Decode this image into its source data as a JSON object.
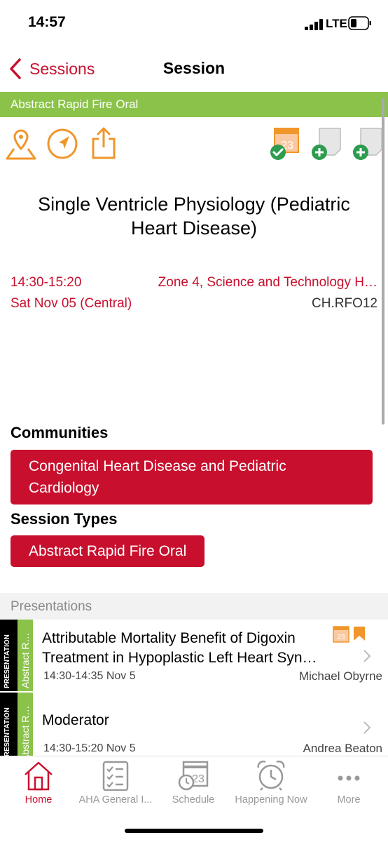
{
  "status": {
    "time": "14:57",
    "network": "LTE"
  },
  "nav": {
    "back_label": "Sessions",
    "title": "Session"
  },
  "banner": {
    "label": "Abstract Rapid Fire Oral"
  },
  "toolbar": {
    "icons": [
      "map-pin-icon",
      "navigate-icon",
      "share-icon",
      "calendar-added-icon",
      "add-note-icon",
      "add-note-icon"
    ],
    "calendar_day": "23"
  },
  "session": {
    "title": "Single Ventricle Physiology (Pediatric Heart Disease)",
    "time": "14:30-15:20",
    "location": "Zone 4,  Science and Technology H…",
    "date": "Sat Nov 05 (Central)",
    "code": "CH.RFO12"
  },
  "communities": {
    "heading": "Communities",
    "items": [
      "Congenital Heart Disease and Pediatric Cardiology"
    ]
  },
  "session_types": {
    "heading": "Session Types",
    "items": [
      "Abstract Rapid Fire Oral"
    ]
  },
  "presentations": {
    "heading": "Presentations",
    "items": [
      {
        "side_label": "PRESENTATION",
        "type_label": "Abstract R…",
        "title_line1": "Attributable Mortality Benefit of Digoxin",
        "title_line2": "Treatment in Hypoplastic Left Heart Syn…",
        "time": "14:30-14:35  Nov 5",
        "speaker": "Michael Obyrne"
      },
      {
        "side_label": "PRESENTATION",
        "type_label": "Abstract R…",
        "title_line1": "Moderator",
        "time": "14:30-15:20  Nov 5",
        "speaker": "Andrea Beaton"
      }
    ]
  },
  "tabs": [
    {
      "label": "Home",
      "icon": "home-icon",
      "active": true
    },
    {
      "label": "AHA General I...",
      "icon": "checklist-icon",
      "active": false
    },
    {
      "label": "Schedule",
      "icon": "schedule-icon",
      "active": false
    },
    {
      "label": "Happening Now",
      "icon": "alarm-clock-icon",
      "active": false
    },
    {
      "label": "More",
      "icon": "more-icon",
      "active": false
    }
  ],
  "colors": {
    "accent": "#c8102e",
    "green": "#8bc34a",
    "orange": "#f0962b"
  }
}
